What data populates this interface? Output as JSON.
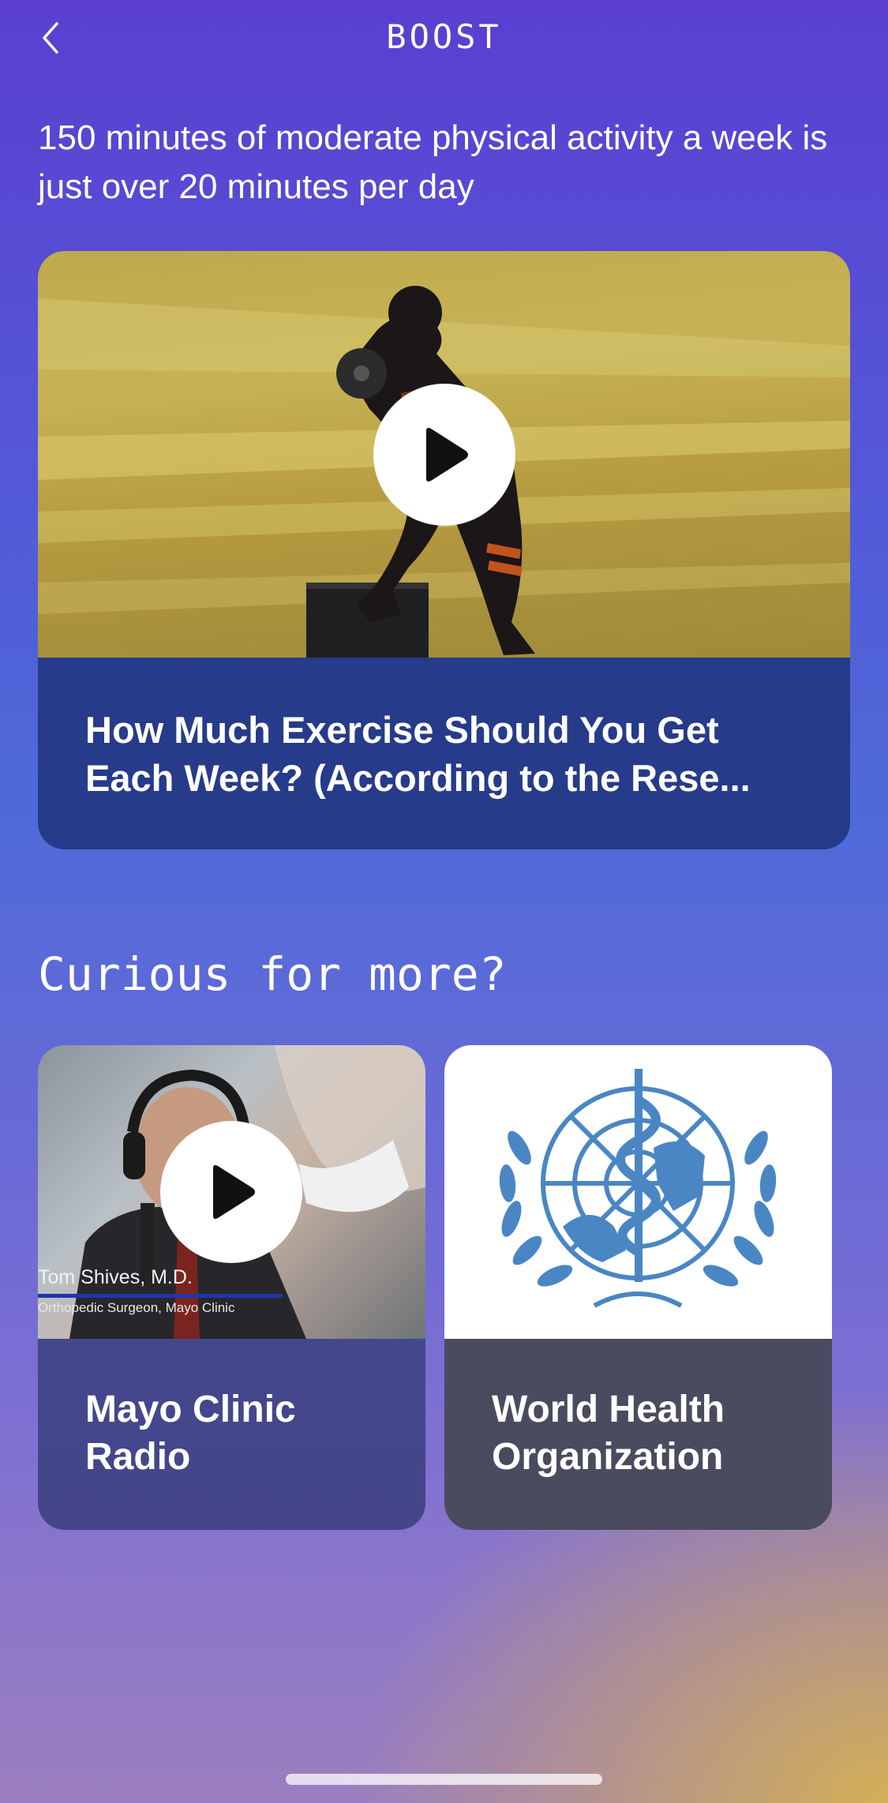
{
  "header": {
    "title": "BOOST",
    "back_icon": "chevron-left-icon"
  },
  "intro_text": "150 minutes of moderate physical activity a week is just over 20 minutes per day",
  "featured": {
    "caption": "How Much Exercise Should You Get Each Week? (According to the Rese...",
    "play_icon": "play-icon"
  },
  "section_title": "Curious for more?",
  "resources": [
    {
      "caption": "Mayo Clinic Radio",
      "thumb_name": "Tom Shives, M.D.",
      "thumb_role": "Orthopedic Surgeon, Mayo Clinic",
      "play_icon": "play-icon"
    },
    {
      "caption": "World Health Organization",
      "logo": "who-emblem"
    }
  ],
  "colors": {
    "card_blue": "#263b8a",
    "who_blue": "#4a86c3",
    "who_card": "#4a4b5e"
  }
}
